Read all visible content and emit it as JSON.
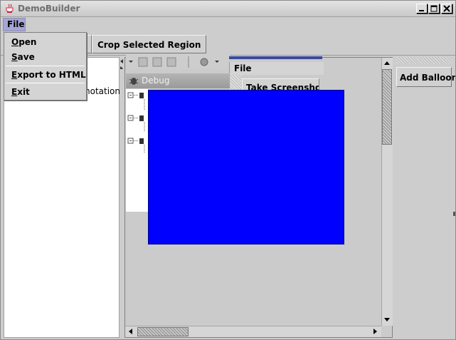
{
  "window": {
    "title": "DemoBuilder"
  },
  "menubar": {
    "file_label": "File"
  },
  "file_menu": {
    "items": [
      {
        "mnemonic": "O",
        "rest": "pen"
      },
      {
        "mnemonic": "S",
        "rest": "ave"
      },
      {
        "mnemonic": "E",
        "rest": "xport to HTML"
      },
      {
        "mnemonic": "E",
        "rest": "xit"
      }
    ]
  },
  "toolbar": {
    "crop_label": "Crop Selected Region"
  },
  "left_panel": {
    "fragment_text": "notation"
  },
  "embedded_app": {
    "debug_label": "Debug",
    "file_label": "File",
    "take_screenshot_label": "Take Screenshot"
  },
  "right_panel": {
    "add_balloon_label": "Add Balloon"
  },
  "colors": {
    "overlay": "#0000ff",
    "menu_highlight": "#a6a6d6"
  }
}
